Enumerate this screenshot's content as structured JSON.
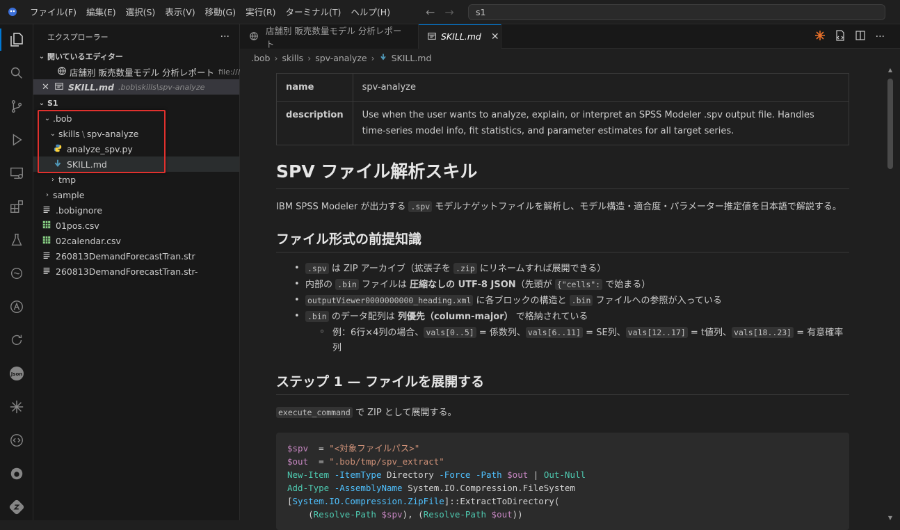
{
  "menu": [
    "ファイル(F)",
    "編集(E)",
    "選択(S)",
    "表示(V)",
    "移動(G)",
    "実行(R)",
    "ターミナル(T)",
    "ヘルプ(H)"
  ],
  "command_center": {
    "value": "s1"
  },
  "sidebar": {
    "title": "エクスプローラー",
    "open_editors": {
      "label": "開いているエディター",
      "items": [
        {
          "name": "店舗別 販売数量モデル 分析レポート",
          "path": "file:///..."
        },
        {
          "name": "SKILL.md",
          "path": ".bob\\skills\\spv-analyze"
        }
      ]
    },
    "workspace": {
      "label": "S1",
      "tree": [
        {
          "label": ".bob"
        },
        {
          "label_a": "skills",
          "sep": "\\",
          "label_b": "spv-analyze"
        },
        {
          "label": "analyze_spv.py"
        },
        {
          "label": "SKILL.md"
        },
        {
          "label": "tmp"
        },
        {
          "label": "sample"
        },
        {
          "label": ".bobignore"
        },
        {
          "label": "01pos.csv"
        },
        {
          "label": "02calendar.csv"
        },
        {
          "label": "260813DemandForecastTran.str"
        },
        {
          "label": "260813DemandForecastTran.str-"
        }
      ]
    }
  },
  "tabs": [
    {
      "label": "店舗別 販売数量モデル 分析レポート"
    },
    {
      "label": "SKILL.md"
    }
  ],
  "breadcrumb": [
    ".bob",
    "skills",
    "spv-analyze",
    "SKILL.md"
  ],
  "doc": {
    "frontmatter": [
      {
        "key": "name",
        "value": "spv-analyze"
      },
      {
        "key": "description",
        "value": "Use when the user wants to analyze, explain, or interpret an SPSS Modeler .spv output file. Handles time-series model info, fit statistics, and parameter estimates for all target series."
      }
    ],
    "h1": "SPV ファイル解析スキル",
    "intro": {
      "a": "IBM SPSS Modeler が出力する ",
      "code": ".spv",
      "b": " モデルナゲットファイルを解析し、モデル構造・適合度・パラメーター推定値を日本語で解説する。"
    },
    "h2_format": "ファイル形式の前提知識",
    "bullets": {
      "b1": {
        "c1": ".spv",
        "t1": " は ZIP アーカイブ（拡張子を ",
        "c2": ".zip",
        "t2": " にリネームすれば展開できる）"
      },
      "b2": {
        "t0": "内部の ",
        "c1": ".bin",
        "t1": " ファイルは ",
        "s1": "圧縮なしの UTF-8 JSON",
        "t2": "（先頭が ",
        "c2": "{\"cells\":",
        "t3": " で始まる）"
      },
      "b3": {
        "c1": "outputViewer0000000000_heading.xml",
        "t1": " に各ブロックの構造と ",
        "c2": ".bin",
        "t2": " ファイルへの参照が入っている"
      },
      "b4": {
        "c1": ".bin",
        "t1": " のデータ配列は ",
        "s1": "列優先（column-major）",
        "t2": " で格納されている"
      },
      "sub": {
        "t0": "例：6行×4列の場合、",
        "c1": "vals[0..5]",
        "t1": " = 係数列、",
        "c2": "vals[6..11]",
        "t2": " = SE列、",
        "c3": "vals[12..17]",
        "t3": " = t値列、",
        "c4": "vals[18..23]",
        "t4": " = 有意確率列"
      }
    },
    "h2_step1": "ステップ 1 — ファイルを展開する",
    "step1_text": {
      "code": "execute_command",
      "t": " で ZIP として展開する。"
    },
    "code_lines": {
      "l1_var": "$spv",
      "l1_eq": "  = ",
      "l1_str": "\"<対象ファイルパス>\"",
      "l2_var": "$out",
      "l2_eq": "  = ",
      "l2_str": "\".bob/tmp/spv_extract\"",
      "l3_cmd": "New-Item",
      "l3_p1": "-ItemType",
      "l3_a1": " Directory ",
      "l3_p2": "-Force",
      "l3_p3": "-Path",
      "l3_v": "$out",
      "l3_pipe": " | ",
      "l3_cmd2": "Out-Null",
      "l4_cmd": "Add-Type",
      "l4_p1": "-AssemblyName",
      "l4_a1": " System.IO.Compression.FileSystem",
      "l5_b1": "[",
      "l5_type": "System.IO.Compression.ZipFile",
      "l5_b2": "]::ExtractToDirectory(",
      "l6_i": "    (",
      "l6_cmd": "Resolve-Path",
      "l6_v": "$spv",
      "l6_m": "), (",
      "l6_cmd2": "Resolve-Path",
      "l6_v2": "$out",
      "l6_e": "))"
    }
  },
  "colors": {
    "accent": "#0078d4",
    "highlight_box": "#e0312e"
  }
}
